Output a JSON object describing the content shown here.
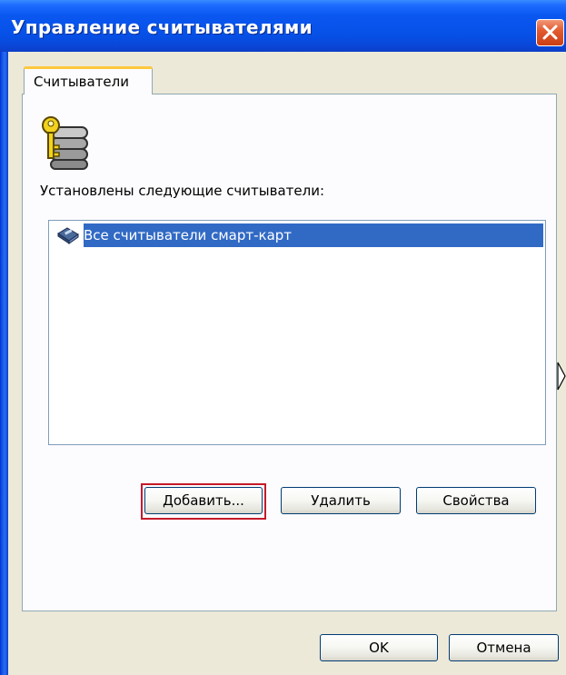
{
  "window": {
    "title": "Управление считывателями"
  },
  "tabs": [
    {
      "label": "Считыватели"
    }
  ],
  "readers_panel": {
    "installed_label": "Установлены следующие считыватели:",
    "readers": [
      {
        "label": "Все считыватели смарт-карт"
      }
    ]
  },
  "actions": {
    "add_label": "Добавить...",
    "remove_label": "Удалить",
    "properties_label": "Свойства"
  },
  "footer": {
    "ok_label": "OK",
    "cancel_label": "Отмена"
  },
  "colors": {
    "titlebar_blue": "#0650e6",
    "selection_blue": "#316ac5",
    "close_red": "#e35c32",
    "highlight_red": "#c41a2a",
    "dialog_face": "#ece9d8"
  },
  "icons": {
    "reader_icon": "key-and-reader-stack-icon",
    "list_item_icon": "smart-card-reader-icon",
    "close_icon": "close-icon"
  }
}
